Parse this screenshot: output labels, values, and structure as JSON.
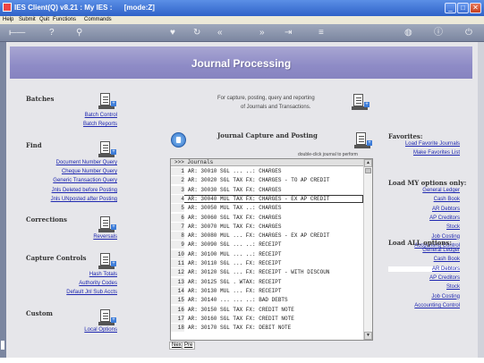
{
  "window": {
    "title": "IES Client(Q) v8.21 : My IES :      [mode:Z]",
    "minimize": "_",
    "maximize": "□",
    "close": "✕"
  },
  "menu": [
    "Help",
    "Submit",
    "Quit",
    "Functions",
    "Commands"
  ],
  "banner": {
    "title": "Journal Processing"
  },
  "batches": {
    "title": "Batches",
    "links": [
      "Batch Control",
      "Batch Reports"
    ]
  },
  "find": {
    "title": "Find",
    "links": [
      "Document Number Query",
      "Cheque Number Query",
      "Generic Transaction Query",
      "Jnls Deleted before Posting",
      "Jnls UNposted after Posting"
    ]
  },
  "corrections": {
    "title": "Corrections",
    "links": [
      "Reversals"
    ]
  },
  "capture_controls": {
    "title": "Capture Controls",
    "links": [
      "Hash Totals",
      "Authority Codes",
      "Default Jnl Sub Accts"
    ]
  },
  "custom": {
    "title": "Custom",
    "links": [
      "Local Options"
    ]
  },
  "center": {
    "info_line1": "For capture, posting, query and reporting",
    "info_line2": "of Journals and Transactions.",
    "section_title": "Journal Capture and Posting",
    "hint": "double-click journal to perform",
    "list_header": ">>> Journals",
    "rows": [
      {
        "n": "1",
        "text": "AR: 30010 SGL ... ..: CHARGES"
      },
      {
        "n": "2",
        "text": "AR: 30020 SGL TAX FX: CHARGES - TO AP CREDIT"
      },
      {
        "n": "3",
        "text": "AR: 30030 SGL TAX FX: CHARGES"
      },
      {
        "n": "4",
        "text": "AR: 30040 MUL TAX FX: CHARGES - EX AP CREDIT"
      },
      {
        "n": "5",
        "text": "AR: 30050 MUL TAX ..: CHARGES"
      },
      {
        "n": "6",
        "text": "AR: 30060 SGL TAX FX: CHARGES"
      },
      {
        "n": "7",
        "text": "AR: 30070 MUL TAX FX: CHARGES"
      },
      {
        "n": "8",
        "text": "AR: 30080 MUL ... FX: CHARGES - EX AP CREDIT"
      },
      {
        "n": "9",
        "text": "AR: 30090 SGL ... ..: RECEIPT"
      },
      {
        "n": "10",
        "text": "AR: 30100 MUL ... ..: RECEIPT"
      },
      {
        "n": "11",
        "text": "AR: 30110 SGL ... FX: RECEIPT"
      },
      {
        "n": "12",
        "text": "AR: 30120 SGL ... FX: RECEIPT - WITH DISCOUN"
      },
      {
        "n": "13",
        "text": "AR: 30125 SGL . WTAX: RECEIPT"
      },
      {
        "n": "14",
        "text": "AR: 30130 MUL ... FX: RECEIPT"
      },
      {
        "n": "15",
        "text": "AR: 30140 ... ... ..: BAD DEBTS"
      },
      {
        "n": "16",
        "text": "AR: 30150 SGL TAX FX: CREDIT NOTE"
      },
      {
        "n": "17",
        "text": "AR: 30160 SGL TAX FX: CREDIT NOTE"
      },
      {
        "n": "18",
        "text": "AR: 30170 SGL TAX FX: DEBIT NOTE"
      }
    ],
    "selected_row": 4,
    "nav": [
      "Nex",
      "Pre"
    ]
  },
  "favorites": {
    "title": "Favorites:",
    "links": [
      "Load Favorite Journals",
      "Make Favorites List"
    ]
  },
  "load_my": {
    "title": "Load MY options only:",
    "links": [
      "General Ledger",
      "Cash Book",
      "AR Debtors",
      "AP Creditors",
      "Stock",
      "Job Costing",
      "Accounting Control"
    ]
  },
  "load_all": {
    "title": "Load ALL options:",
    "links": [
      "General Ledger",
      "Cash Book",
      "AR Debtors",
      "AP Creditors",
      "Stock",
      "Job Costing",
      "Accounting Control"
    ],
    "highlighted": 2
  }
}
